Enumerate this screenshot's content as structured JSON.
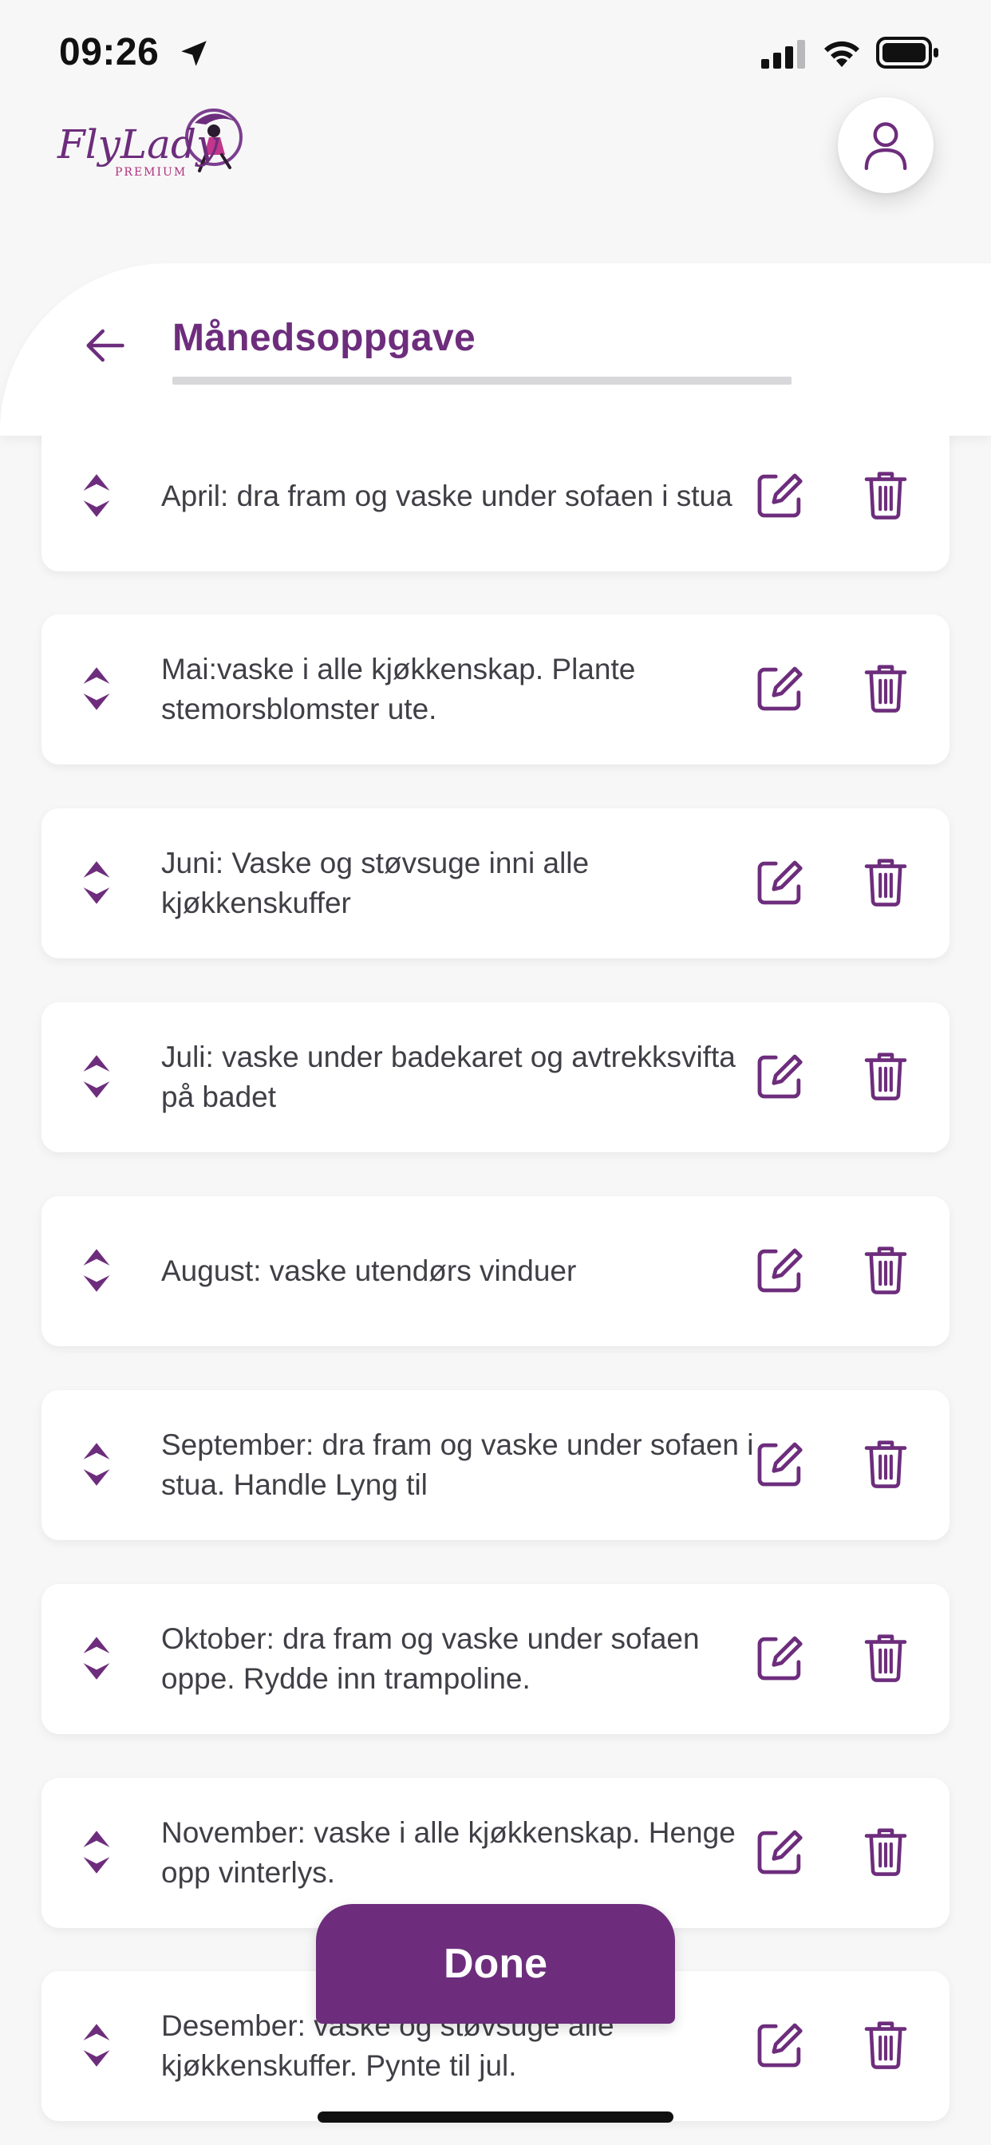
{
  "status_bar": {
    "time": "09:26",
    "icons": [
      "location-arrow-icon",
      "cellular-signal-icon",
      "wifi-icon",
      "battery-icon"
    ]
  },
  "header": {
    "logo_text": "FlyLady",
    "logo_subtext": "PREMIUM",
    "profile_icon": "user-icon"
  },
  "title_bar": {
    "back_icon": "arrow-left-icon",
    "title": "Månedsoppgave"
  },
  "tasks": [
    {
      "text": "April: dra fram og vaske under sofaen i stua"
    },
    {
      "text": "Mai:vaske i alle kjøkkenskap. Plante stemorsblomster ute."
    },
    {
      "text": "Juni: Vaske og støvsuge inni alle kjøkkenskuffer"
    },
    {
      "text": "Juli: vaske under badekaret og avtrekksvifta på badet"
    },
    {
      "text": "August: vaske utendørs vinduer"
    },
    {
      "text": "September: dra fram og vaske under sofaen i stua. Handle Lyng til"
    },
    {
      "text": "Oktober: dra fram og vaske under sofaen oppe. Rydde inn trampoline."
    },
    {
      "text": "November: vaske i alle kjøkkenskap. Henge opp vinterlys."
    },
    {
      "text": "Desember: vaske og støvsuge alle kjøkkenskuffer. Pynte til jul."
    }
  ],
  "row_icons": {
    "reorder": "reorder-arrows-icon",
    "edit": "edit-icon",
    "delete": "trash-icon"
  },
  "done_button": {
    "label": "Done"
  },
  "colors": {
    "accent": "#6d2d7c",
    "background": "#f7f7f8",
    "card": "#ffffff",
    "text": "#3f3f46"
  }
}
